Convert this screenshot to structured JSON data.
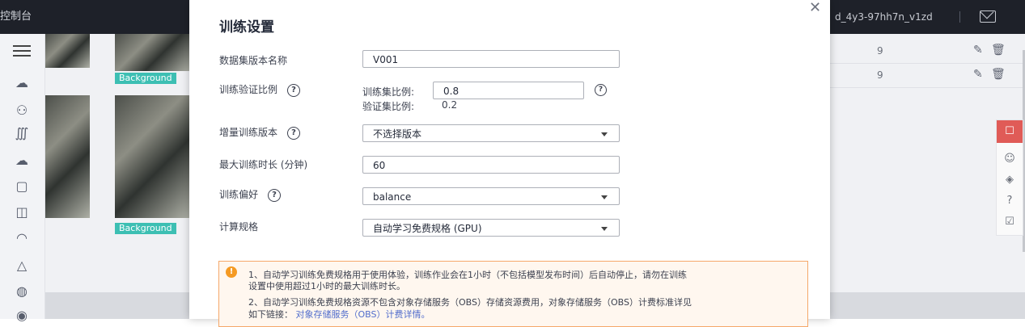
{
  "topbar": {
    "console_label": "控制台",
    "project_id": "d_4y3-97hh7n_v1zd"
  },
  "background": {
    "tag1": "Background",
    "tag2": "Background",
    "rows": [
      {
        "count": "9"
      },
      {
        "count": "9"
      }
    ]
  },
  "modal": {
    "title": "训练设置",
    "fields": {
      "dataset_version": {
        "label": "数据集版本名称",
        "value": "V001"
      },
      "split": {
        "label": "训练验证比例",
        "train_label": "训练集比例:",
        "train_value": "0.8",
        "val_label": "验证集比例:",
        "val_value": "0.2"
      },
      "incremental": {
        "label": "增量训练版本",
        "value": "不选择版本"
      },
      "max_time": {
        "label": "最大训练时长 (分钟)",
        "value": "60"
      },
      "preference": {
        "label": "训练偏好",
        "value": "balance"
      },
      "spec": {
        "label": "计算规格",
        "value": "自动学习免费规格 (GPU)"
      }
    },
    "notice": {
      "line1a": "1、自动学习训练免费规格用于使用体验，训练作业会在1小时（不包括模型发布时间）后自动停止，请勿在训练",
      "line1b": "设置中使用超过1小时的最大训练时长。",
      "line2a": "2、自动学习训练免费规格资源不包含对象存储服务（OBS）存储资源费用，对象存储服务（OBS）计费标准详见",
      "line2b": "如下链接：",
      "link": "对象存储服务（OBS）计费详情。"
    }
  }
}
